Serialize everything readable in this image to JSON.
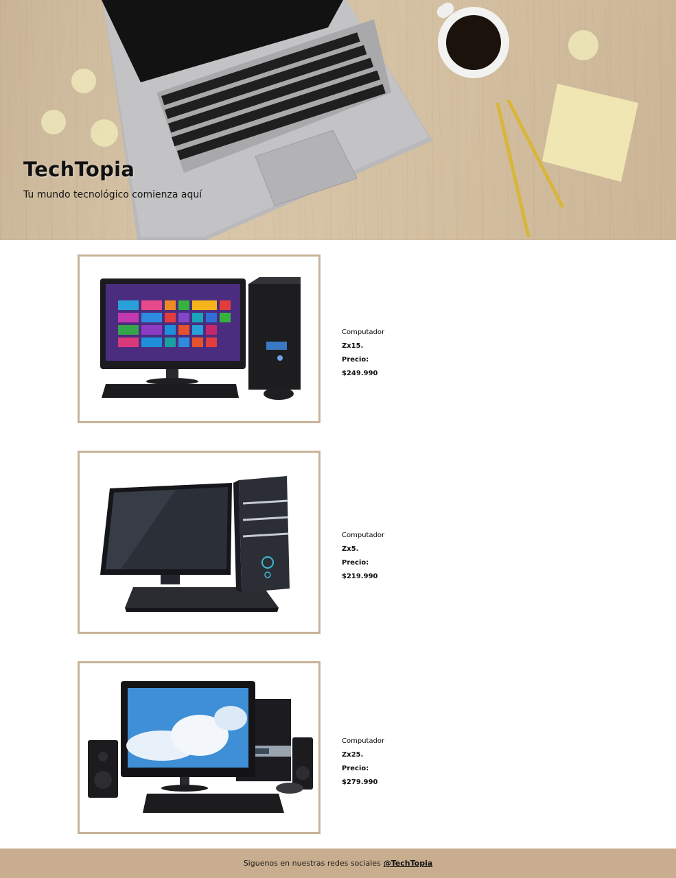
{
  "hero": {
    "title_bold": "Tech",
    "title_light": "Topia",
    "subtitle": "Tu mundo tecnológico comienza aquí"
  },
  "products": [
    {
      "name_prefix": "Computador ",
      "name_model": "Zx15.",
      "price": "Precio: $249.990"
    },
    {
      "name_prefix": "Computador ",
      "name_model": "Zx5.",
      "price": "Precio: $219.990"
    },
    {
      "name_prefix": "Computador ",
      "name_model": "Zx25.",
      "price": "Precio: $279.990"
    }
  ],
  "footer": {
    "text": "Siguenos en nuestras redes sociales",
    "handle": "@TechTopia"
  },
  "colors": {
    "frame_border": "#c8b299",
    "footer_bg": "#c8ae8e"
  }
}
